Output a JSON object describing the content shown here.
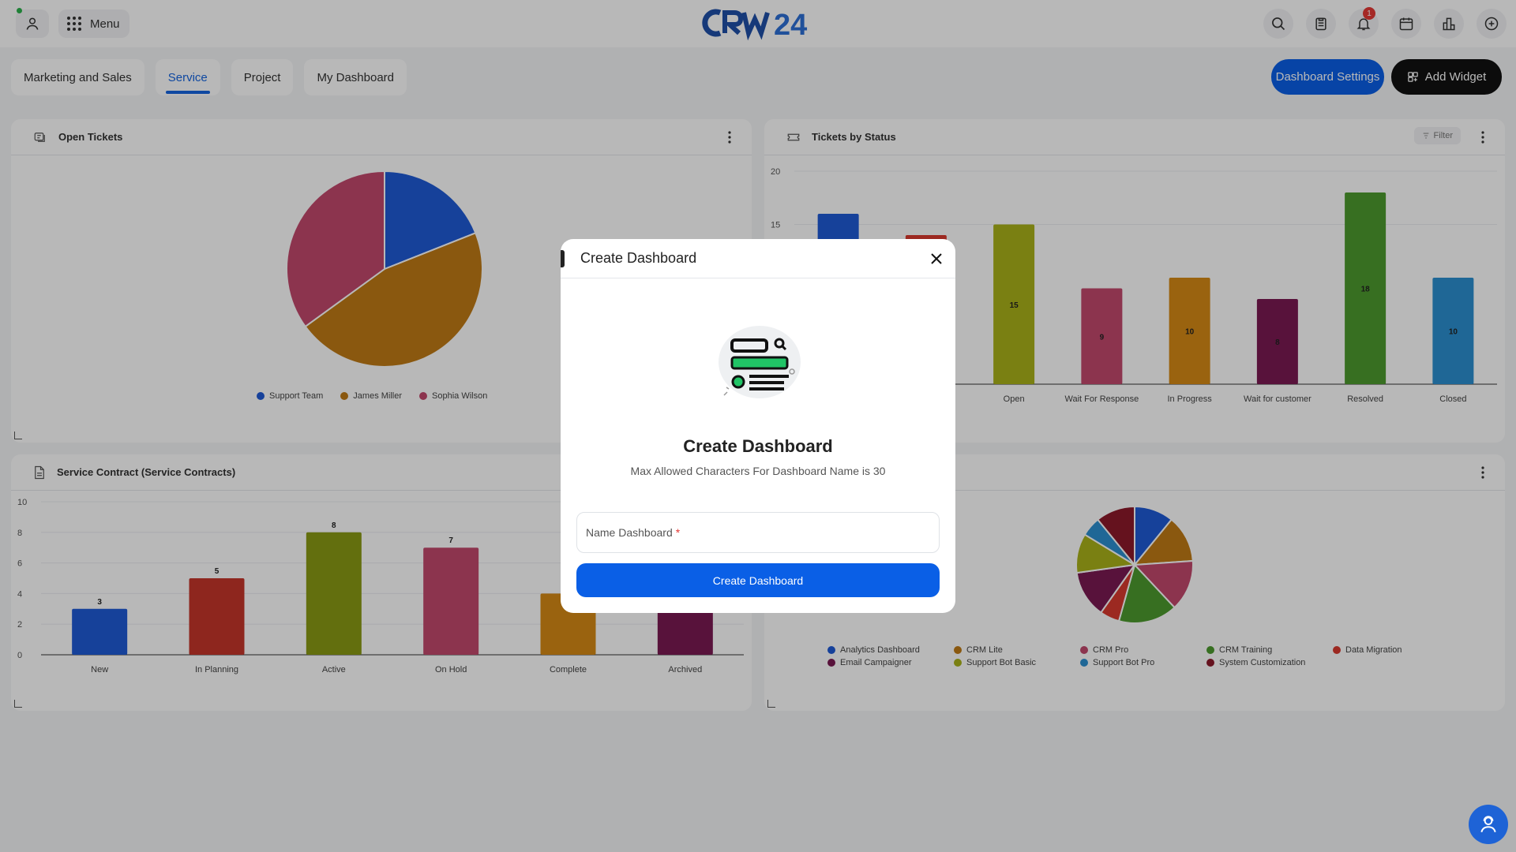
{
  "header": {
    "menu_label": "Menu",
    "logo_text": "CRM24",
    "notification_count": "1",
    "icons": [
      "search-icon",
      "clipboard-icon",
      "bell-icon",
      "calendar-icon",
      "bar-chart-icon",
      "add-circle-icon"
    ]
  },
  "tabs": [
    {
      "label": "Marketing and Sales",
      "active": false
    },
    {
      "label": "Service",
      "active": true
    },
    {
      "label": "Project",
      "active": false
    },
    {
      "label": "My Dashboard",
      "active": false
    }
  ],
  "actions": {
    "settings_label": "Dashboard Settings",
    "add_widget_label": "Add Widget"
  },
  "widgets": {
    "open_tickets": {
      "title": "Open Tickets"
    },
    "tickets_by_status": {
      "title": "Tickets by Status",
      "filter_label": "Filter"
    },
    "service_contract": {
      "title": "Service Contract (Service Contracts)"
    }
  },
  "modal": {
    "header_title": "Create Dashboard",
    "title": "Create Dashboard",
    "subtitle": "Max Allowed Characters For Dashboard Name is 30",
    "input_label": "Name Dashboard",
    "required_mark": "*",
    "submit_label": "Create Dashboard"
  },
  "colors": {
    "accent": "#0a5fe6",
    "dark": "#111111",
    "overlay": "rgba(0,0,0,0.28)"
  },
  "chart_data": [
    {
      "type": "pie",
      "title": "Open Tickets",
      "labels": [
        "Support Team",
        "James Miller",
        "Sophia Wilson"
      ],
      "values": [
        19,
        46,
        35
      ],
      "colors": [
        "#1f5ad6",
        "#c07a16",
        "#c2486d"
      ],
      "legend": "bottom"
    },
    {
      "type": "bar",
      "title": "Tickets by Status",
      "categories": [
        "",
        "",
        "Open",
        "Wait For Response",
        "In Progress",
        "Wait for customer",
        "Resolved",
        "Closed"
      ],
      "values": [
        16,
        14,
        15,
        9,
        10,
        8,
        18,
        10
      ],
      "labels": [
        "",
        "",
        "15",
        "9",
        "10",
        "8",
        "18",
        "10"
      ],
      "colors": [
        "#1f5ad6",
        "#d93a2e",
        "#a9b21a",
        "#c2486d",
        "#d68a16",
        "#7a1a52",
        "#4d9a2e",
        "#2c8fd0"
      ],
      "ylim": [
        0,
        20
      ],
      "yticks": [
        "15",
        "20"
      ]
    },
    {
      "type": "bar",
      "title": "Service Contract (Service Contracts)",
      "categories": [
        "New",
        "In Planning",
        "Active",
        "On Hold",
        "Complete",
        "Archived"
      ],
      "values": [
        3,
        5,
        8,
        7,
        4,
        3
      ],
      "labels": [
        "3",
        "5",
        "8",
        "7",
        "",
        ""
      ],
      "colors": [
        "#1f5ad6",
        "#c5352a",
        "#8a9a14",
        "#c2486d",
        "#d68a16",
        "#7a1a52"
      ],
      "ylim": [
        0,
        10
      ],
      "yticks": [
        "0",
        "2",
        "4",
        "6",
        "8",
        "10"
      ]
    },
    {
      "type": "pie",
      "labels": [
        "Analytics Dashboard",
        "CRM Lite",
        "CRM Pro",
        "CRM Training",
        "Data Migration",
        "Email Campaigner",
        "Support Bot Basic",
        "Support Bot Pro",
        "System Customization"
      ],
      "values": [
        10,
        12,
        13,
        15,
        5,
        12,
        10,
        5,
        10
      ],
      "colors": [
        "#1f5ad6",
        "#c07a16",
        "#c2486d",
        "#4d9a2e",
        "#d93a2e",
        "#7a1a52",
        "#a9b21a",
        "#2c8fd0",
        "#8c1a2a"
      ],
      "legend": "bottom"
    }
  ]
}
